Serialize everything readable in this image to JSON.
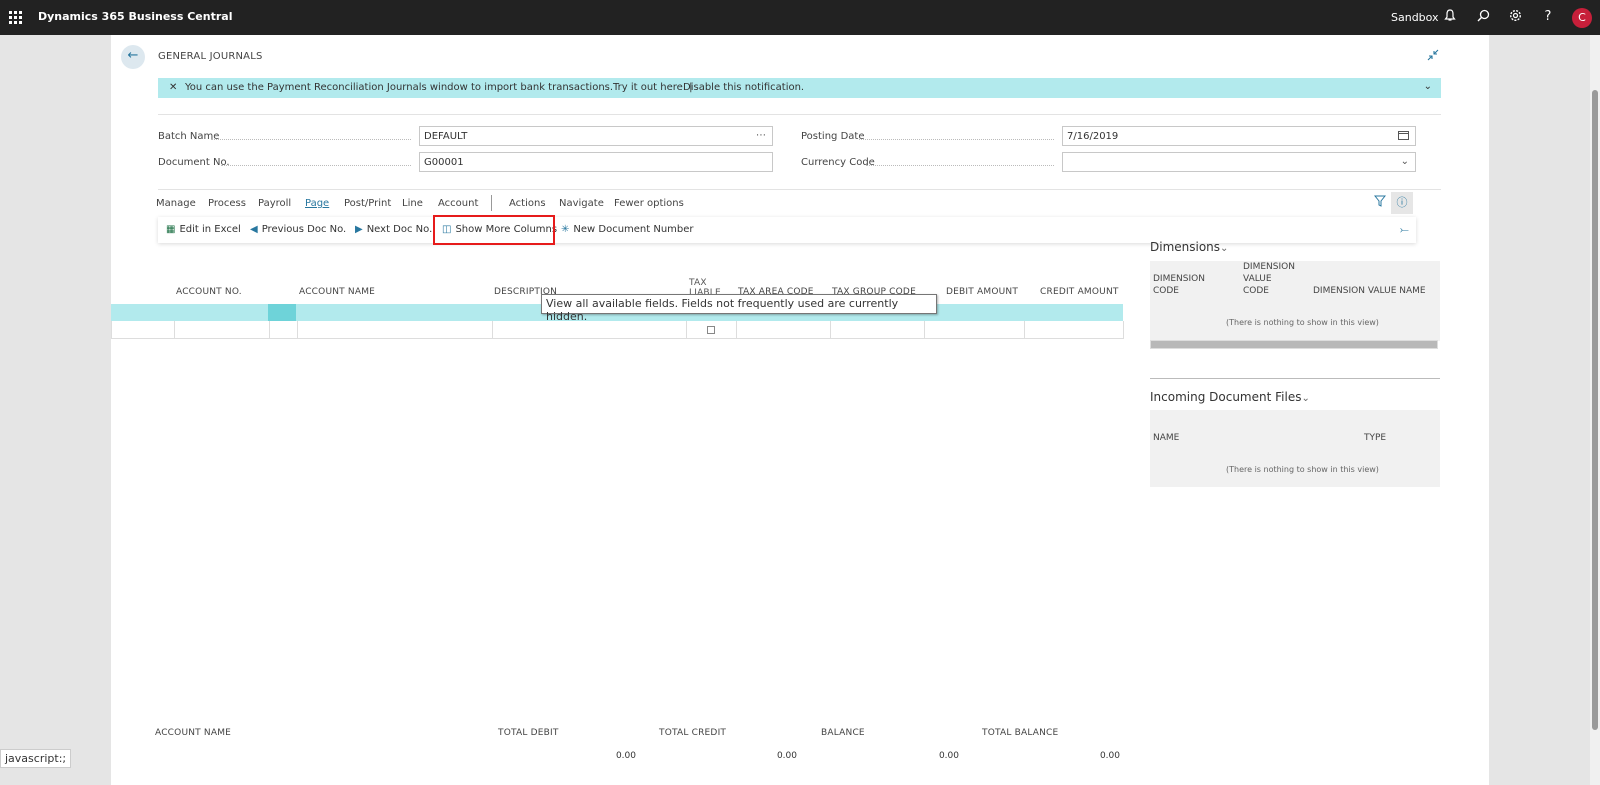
{
  "app": {
    "title": "Dynamics 365 Business Central",
    "environment": "Sandbox",
    "user_initial": "C"
  },
  "page": {
    "title": "GENERAL JOURNALS",
    "notification": {
      "message": "You can use the Payment Reconciliation Journals window to import bank transactions.",
      "try_link": "Try it out here. |",
      "disable_link": "Disable this notification."
    },
    "fields": {
      "batch_name_label": "Batch Name",
      "batch_name_value": "DEFAULT",
      "document_no_label": "Document No.",
      "document_no_value": "G00001",
      "posting_date_label": "Posting Date",
      "posting_date_value": "7/16/2019",
      "currency_code_label": "Currency Code",
      "currency_code_value": ""
    },
    "menu": [
      "Manage",
      "Process",
      "Payroll",
      "Page",
      "Post/Print",
      "Line",
      "Account",
      "Actions",
      "Navigate",
      "Fewer options"
    ],
    "actions": {
      "edit_excel": "Edit in Excel",
      "prev_doc": "Previous Doc No.",
      "next_doc": "Next Doc No.",
      "show_more": "Show More Columns",
      "new_doc_number": "New Document Number"
    },
    "tooltip": "View all available fields. Fields not frequently used are currently hidden.",
    "columns": {
      "account_no": "ACCOUNT NO.",
      "account_name": "ACCOUNT NAME",
      "description": "DESCRIPTION",
      "tax_liable": "TAX LIABLE",
      "tax_area_code": "TAX AREA CODE",
      "tax_group_code": "TAX GROUP CODE",
      "debit_amount": "DEBIT AMOUNT",
      "credit_amount": "CREDIT AMOUNT"
    },
    "totals": {
      "account_name_label": "ACCOUNT NAME",
      "total_debit_label": "TOTAL DEBIT",
      "total_credit_label": "TOTAL CREDIT",
      "balance_label": "BALANCE",
      "total_balance_label": "TOTAL BALANCE",
      "total_debit": "0.00",
      "total_credit": "0.00",
      "balance": "0.00",
      "total_balance": "0.00"
    }
  },
  "factbox": {
    "dimensions": {
      "title": "Dimensions",
      "col1": "DIMENSION CODE",
      "col2": "DIMENSION VALUE CODE",
      "col3": "DIMENSION VALUE NAME",
      "empty": "(There is nothing to show in this view)"
    },
    "incoming": {
      "title": "Incoming Document Files",
      "col1": "NAME",
      "col2": "TYPE",
      "empty": "(There is nothing to show in this view)"
    }
  },
  "statusbar": "javascript:;",
  "colors": {
    "accent": "#28779f",
    "notification_bg": "#b2eaed",
    "highlight": "#e61b1b",
    "topbar": "#222222"
  }
}
